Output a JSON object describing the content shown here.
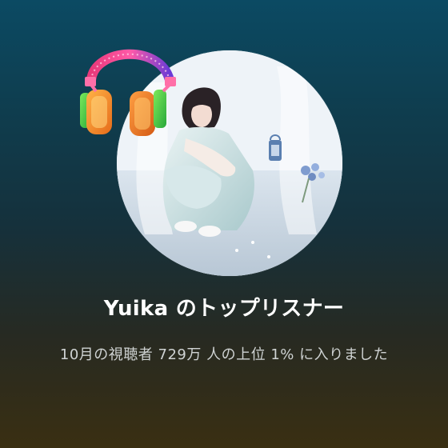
{
  "card": {
    "title": "Yuika のトップリスナー",
    "subtitle": "10月の視聴者 729万 人の上位 1% に入りました"
  },
  "icons": {
    "headphones": "headphones-icon",
    "avatar": "artist-avatar"
  },
  "colors": {
    "background_top": "#0b4a63",
    "background_bottom": "#3a2f12",
    "title": "#ffffff",
    "subtitle": "#cfd3d3"
  }
}
